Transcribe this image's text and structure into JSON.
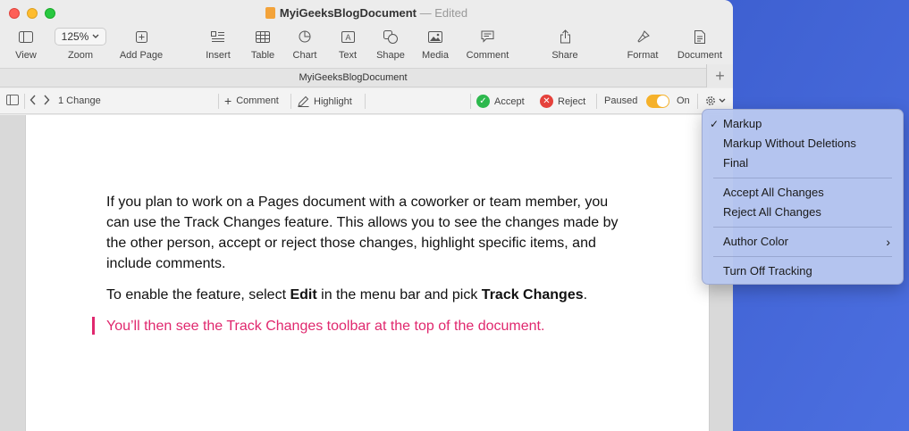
{
  "window": {
    "title": "MyiGeeksBlogDocument",
    "edited": "— Edited",
    "tab_title": "MyiGeeksBlogDocument"
  },
  "toolbar": {
    "view": "View",
    "zoom_value": "125%",
    "zoom": "Zoom",
    "add_page": "Add Page",
    "insert": "Insert",
    "table": "Table",
    "chart": "Chart",
    "text": "Text",
    "shape": "Shape",
    "media": "Media",
    "comment": "Comment",
    "share": "Share",
    "format": "Format",
    "document": "Document"
  },
  "tracking": {
    "changes": "1 Change",
    "comment": "Comment",
    "highlight": "Highlight",
    "accept": "Accept",
    "reject": "Reject",
    "paused": "Paused",
    "on": "On",
    "accept_color": "#2db84d",
    "reject_color": "#e5413b",
    "toggle_color": "#f5b12a"
  },
  "document": {
    "para1": "If you plan to work on a Pages document with a coworker or team member, you can use the Track Changes feature. This allows you to see the changes made by the other person, accept or reject those changes, highlight specific items, and include comments.",
    "para2_a": "To enable the feature, select ",
    "para2_b": "Edit",
    "para2_c": " in the menu bar and pick ",
    "para2_d": "Track Changes",
    "para2_e": ".",
    "para3": "You’ll then see the Track Changes toolbar at the top of the document.",
    "change_color": "#e0286e"
  },
  "menu": {
    "markup": "Markup",
    "markup_no_del": "Markup Without Deletions",
    "final": "Final",
    "accept_all": "Accept All Changes",
    "reject_all": "Reject All Changes",
    "author_color": "Author Color",
    "turn_off": "Turn Off Tracking",
    "checkmark": "✓",
    "submenu_arrow": "›"
  }
}
